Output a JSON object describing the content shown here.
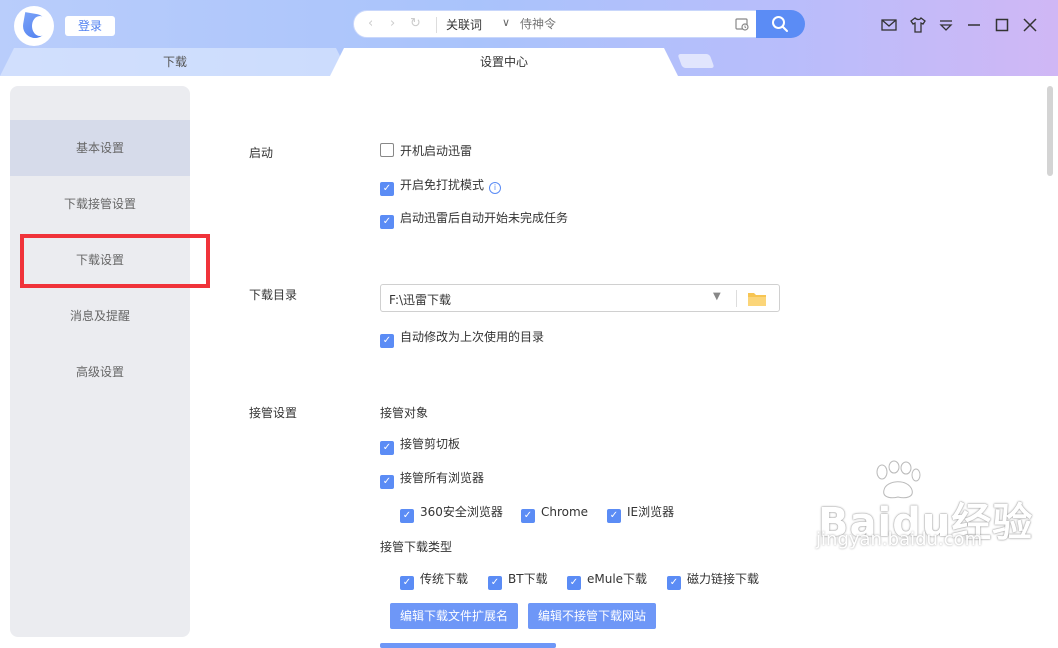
{
  "header": {
    "login_label": "登录",
    "search": {
      "keyword_label": "关联词",
      "placeholder": "侍神令"
    }
  },
  "tabs": [
    {
      "label": "下载"
    },
    {
      "label": "设置中心"
    }
  ],
  "sidebar": {
    "items": [
      {
        "label": "基本设置",
        "active": true
      },
      {
        "label": "下载接管设置",
        "active": false
      },
      {
        "label": "下载设置",
        "active": false
      },
      {
        "label": "消息及提醒",
        "active": false
      },
      {
        "label": "高级设置",
        "active": false
      }
    ]
  },
  "settings": {
    "startup": {
      "label": "启动",
      "options": [
        {
          "label": "开机启动迅雷",
          "checked": false
        },
        {
          "label": "开启免打扰模式",
          "checked": true
        },
        {
          "label": "启动迅雷后自动开始未完成任务",
          "checked": true
        }
      ]
    },
    "download_dir": {
      "label": "下载目录",
      "value": "F:\\迅雷下载",
      "auto_modify": {
        "label": "自动修改为上次使用的目录",
        "checked": true
      }
    },
    "takeover": {
      "label": "接管设置",
      "targets_heading": "接管对象",
      "clipboard": {
        "label": "接管剪切板",
        "checked": true
      },
      "all_browsers": {
        "label": "接管所有浏览器",
        "checked": true
      },
      "browsers": [
        {
          "label": "360安全浏览器",
          "checked": true
        },
        {
          "label": "Chrome",
          "checked": true
        },
        {
          "label": "IE浏览器",
          "checked": true
        }
      ],
      "types_heading": "接管下载类型",
      "types": [
        {
          "label": "传统下载",
          "checked": true
        },
        {
          "label": "BT下载",
          "checked": true
        },
        {
          "label": "eMule下载",
          "checked": true
        },
        {
          "label": "磁力链接下载",
          "checked": true
        }
      ],
      "edit_ext_button": "编辑下载文件扩展名",
      "edit_sites_button": "编辑不接管下载网站"
    }
  },
  "watermark": {
    "brand": "Baidu经验",
    "url": "jingyan.baidu.com"
  },
  "colors": {
    "accent": "#5b8cf5",
    "highlight": "#f0333a"
  }
}
